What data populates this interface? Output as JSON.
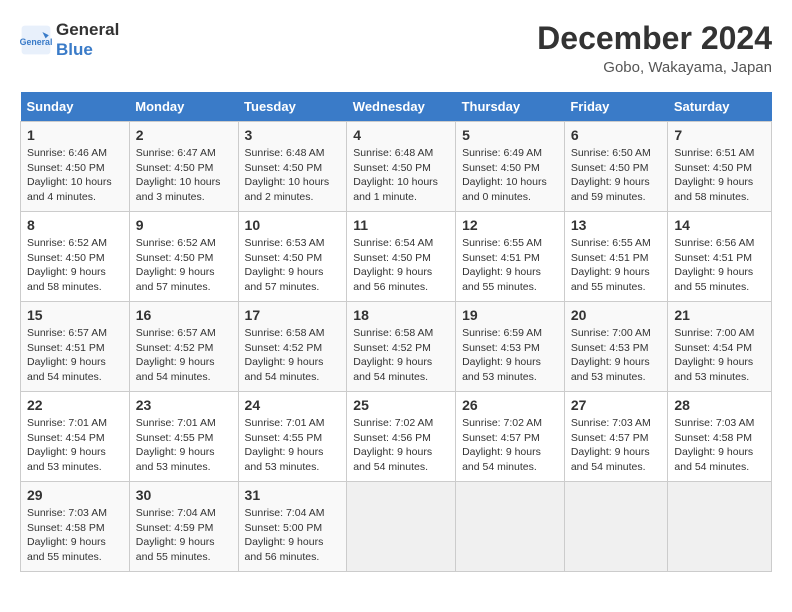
{
  "header": {
    "logo_line1": "General",
    "logo_line2": "Blue",
    "month_year": "December 2024",
    "location": "Gobo, Wakayama, Japan"
  },
  "columns": [
    "Sunday",
    "Monday",
    "Tuesday",
    "Wednesday",
    "Thursday",
    "Friday",
    "Saturday"
  ],
  "weeks": [
    [
      {
        "day": "1",
        "info": "Sunrise: 6:46 AM\nSunset: 4:50 PM\nDaylight: 10 hours\nand 4 minutes."
      },
      {
        "day": "2",
        "info": "Sunrise: 6:47 AM\nSunset: 4:50 PM\nDaylight: 10 hours\nand 3 minutes."
      },
      {
        "day": "3",
        "info": "Sunrise: 6:48 AM\nSunset: 4:50 PM\nDaylight: 10 hours\nand 2 minutes."
      },
      {
        "day": "4",
        "info": "Sunrise: 6:48 AM\nSunset: 4:50 PM\nDaylight: 10 hours\nand 1 minute."
      },
      {
        "day": "5",
        "info": "Sunrise: 6:49 AM\nSunset: 4:50 PM\nDaylight: 10 hours\nand 0 minutes."
      },
      {
        "day": "6",
        "info": "Sunrise: 6:50 AM\nSunset: 4:50 PM\nDaylight: 9 hours\nand 59 minutes."
      },
      {
        "day": "7",
        "info": "Sunrise: 6:51 AM\nSunset: 4:50 PM\nDaylight: 9 hours\nand 58 minutes."
      }
    ],
    [
      {
        "day": "8",
        "info": "Sunrise: 6:52 AM\nSunset: 4:50 PM\nDaylight: 9 hours\nand 58 minutes."
      },
      {
        "day": "9",
        "info": "Sunrise: 6:52 AM\nSunset: 4:50 PM\nDaylight: 9 hours\nand 57 minutes."
      },
      {
        "day": "10",
        "info": "Sunrise: 6:53 AM\nSunset: 4:50 PM\nDaylight: 9 hours\nand 57 minutes."
      },
      {
        "day": "11",
        "info": "Sunrise: 6:54 AM\nSunset: 4:50 PM\nDaylight: 9 hours\nand 56 minutes."
      },
      {
        "day": "12",
        "info": "Sunrise: 6:55 AM\nSunset: 4:51 PM\nDaylight: 9 hours\nand 55 minutes."
      },
      {
        "day": "13",
        "info": "Sunrise: 6:55 AM\nSunset: 4:51 PM\nDaylight: 9 hours\nand 55 minutes."
      },
      {
        "day": "14",
        "info": "Sunrise: 6:56 AM\nSunset: 4:51 PM\nDaylight: 9 hours\nand 55 minutes."
      }
    ],
    [
      {
        "day": "15",
        "info": "Sunrise: 6:57 AM\nSunset: 4:51 PM\nDaylight: 9 hours\nand 54 minutes."
      },
      {
        "day": "16",
        "info": "Sunrise: 6:57 AM\nSunset: 4:52 PM\nDaylight: 9 hours\nand 54 minutes."
      },
      {
        "day": "17",
        "info": "Sunrise: 6:58 AM\nSunset: 4:52 PM\nDaylight: 9 hours\nand 54 minutes."
      },
      {
        "day": "18",
        "info": "Sunrise: 6:58 AM\nSunset: 4:52 PM\nDaylight: 9 hours\nand 54 minutes."
      },
      {
        "day": "19",
        "info": "Sunrise: 6:59 AM\nSunset: 4:53 PM\nDaylight: 9 hours\nand 53 minutes."
      },
      {
        "day": "20",
        "info": "Sunrise: 7:00 AM\nSunset: 4:53 PM\nDaylight: 9 hours\nand 53 minutes."
      },
      {
        "day": "21",
        "info": "Sunrise: 7:00 AM\nSunset: 4:54 PM\nDaylight: 9 hours\nand 53 minutes."
      }
    ],
    [
      {
        "day": "22",
        "info": "Sunrise: 7:01 AM\nSunset: 4:54 PM\nDaylight: 9 hours\nand 53 minutes."
      },
      {
        "day": "23",
        "info": "Sunrise: 7:01 AM\nSunset: 4:55 PM\nDaylight: 9 hours\nand 53 minutes."
      },
      {
        "day": "24",
        "info": "Sunrise: 7:01 AM\nSunset: 4:55 PM\nDaylight: 9 hours\nand 53 minutes."
      },
      {
        "day": "25",
        "info": "Sunrise: 7:02 AM\nSunset: 4:56 PM\nDaylight: 9 hours\nand 54 minutes."
      },
      {
        "day": "26",
        "info": "Sunrise: 7:02 AM\nSunset: 4:57 PM\nDaylight: 9 hours\nand 54 minutes."
      },
      {
        "day": "27",
        "info": "Sunrise: 7:03 AM\nSunset: 4:57 PM\nDaylight: 9 hours\nand 54 minutes."
      },
      {
        "day": "28",
        "info": "Sunrise: 7:03 AM\nSunset: 4:58 PM\nDaylight: 9 hours\nand 54 minutes."
      }
    ],
    [
      {
        "day": "29",
        "info": "Sunrise: 7:03 AM\nSunset: 4:58 PM\nDaylight: 9 hours\nand 55 minutes."
      },
      {
        "day": "30",
        "info": "Sunrise: 7:04 AM\nSunset: 4:59 PM\nDaylight: 9 hours\nand 55 minutes."
      },
      {
        "day": "31",
        "info": "Sunrise: 7:04 AM\nSunset: 5:00 PM\nDaylight: 9 hours\nand 56 minutes."
      },
      {
        "day": "",
        "info": ""
      },
      {
        "day": "",
        "info": ""
      },
      {
        "day": "",
        "info": ""
      },
      {
        "day": "",
        "info": ""
      }
    ]
  ]
}
